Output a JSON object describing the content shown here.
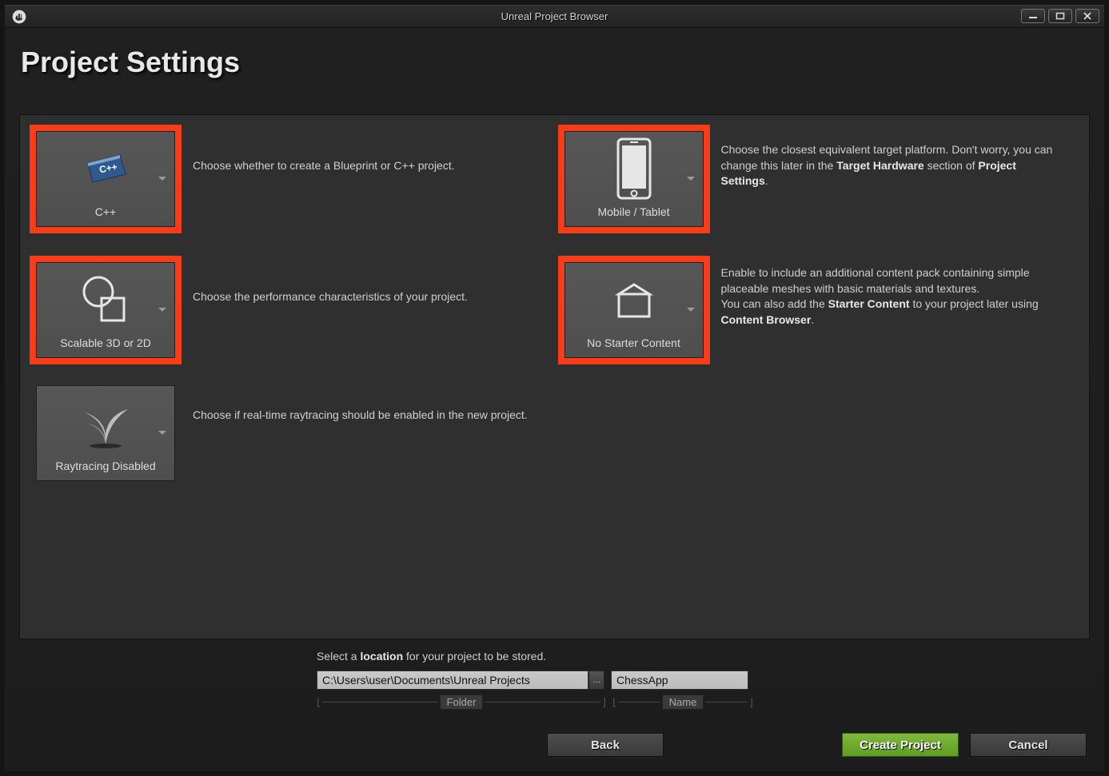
{
  "window": {
    "title": "Unreal Project Browser"
  },
  "heading": "Project Settings",
  "cards": {
    "cpp": {
      "label": "C++",
      "desc": "Choose whether to create a Blueprint or C++ project."
    },
    "mobile": {
      "label": "Mobile / Tablet",
      "desc_pre": "Choose the closest equivalent target platform. Don't worry, you can change this later in the ",
      "desc_b1": "Target Hardware",
      "desc_mid": " section of ",
      "desc_b2": "Project Settings",
      "desc_post": "."
    },
    "scalable": {
      "label": "Scalable 3D or 2D",
      "desc": "Choose the performance characteristics of your project."
    },
    "nostarter": {
      "label": "No Starter Content",
      "desc_l1": "Enable to include an additional content pack containing simple placeable meshes with basic materials and textures.",
      "desc_l2a": "You can also add the ",
      "desc_b1": "Starter Content",
      "desc_l2b": " to your project later using ",
      "desc_b2": "Content Browser",
      "desc_l2c": "."
    },
    "raytrace": {
      "label": "Raytracing Disabled",
      "desc": "Choose if real-time raytracing should be enabled in the new project."
    }
  },
  "location": {
    "hint_pre": "Select a ",
    "hint_b": "location",
    "hint_post": " for your project to be stored.",
    "folder_value": "C:\\Users\\user\\Documents\\Unreal Projects",
    "name_value": "ChessApp",
    "folder_label": "Folder",
    "name_label": "Name"
  },
  "buttons": {
    "back": "Back",
    "create": "Create Project",
    "cancel": "Cancel"
  }
}
